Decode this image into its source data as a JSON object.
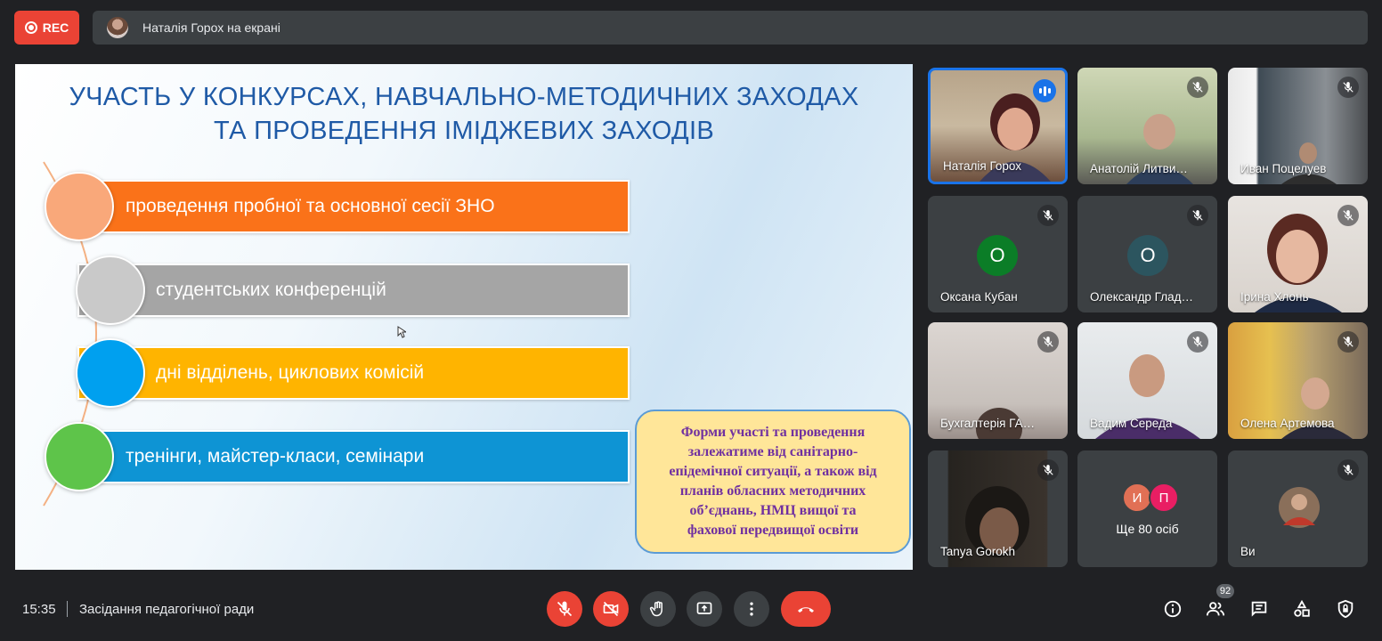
{
  "top_bar": {
    "rec_label": "REC",
    "presenter_text": "Наталія Горох на екрані"
  },
  "slide": {
    "title_line1": "УЧАСТЬ У КОНКУРСАХ, НАВЧАЛЬНО-МЕТОДИЧНИХ ЗАХОДАХ",
    "title_line2": "ТА ПРОВЕДЕННЯ ІМІДЖЕВИХ ЗАХОДІВ",
    "items": [
      {
        "label": "проведення пробної та основної сесії ЗНО",
        "bar_color": "#fa7219",
        "circle_color": "#f9a87a"
      },
      {
        "label": "студентських конференцій",
        "bar_color": "#a5a5a5",
        "circle_color": "#c9c9c9"
      },
      {
        "label": "дні відділень, циклових комісій",
        "bar_color": "#ffb400",
        "circle_color": "#00a0ef"
      },
      {
        "label": "тренінги, майстер-класи, семінари",
        "bar_color": "#0e94d4",
        "circle_color": "#5ec44a"
      }
    ],
    "note_lines": [
      "Форми  участі та проведення",
      "залежатиме від санітарно-",
      "епідемічної ситуації, а також від",
      "планів обласних методичних",
      "об’єднань,  НМЦ вищої та",
      "фахової передвищої освіти"
    ]
  },
  "participants": [
    {
      "name": "Наталія Горох",
      "state": "speaking"
    },
    {
      "name": "Анатолій Литви…",
      "state": "muted"
    },
    {
      "name": "Иван Поцелуев",
      "state": "muted"
    },
    {
      "name": "Оксана Кубан",
      "state": "muted",
      "initial": "О",
      "avatar_color": "#0b7d27"
    },
    {
      "name": "Олександр Глад…",
      "state": "muted",
      "initial": "О",
      "avatar_color": "#2c555f"
    },
    {
      "name": "Ірина Хлонь",
      "state": "muted"
    },
    {
      "name": "Бухгалтерія ГА…",
      "state": "muted"
    },
    {
      "name": "Вадим Середа",
      "state": "muted"
    },
    {
      "name": "Олена Артемова",
      "state": "muted"
    },
    {
      "name": "Tanya Gorokh",
      "state": "muted"
    },
    {
      "name": "Ще 80 осіб",
      "initials": [
        "И",
        "П"
      ],
      "avatar_colors": [
        "#e17055",
        "#e91e63"
      ]
    },
    {
      "name": "Ви",
      "state": "muted"
    }
  ],
  "bottom_bar": {
    "time": "15:35",
    "meeting_title": "Засідання педагогічної ради",
    "people_count": "92"
  },
  "colors": {
    "danger": "#ea4335",
    "control_grey": "#3c4043",
    "background": "#202124",
    "speaking_accent": "#1a73e8"
  }
}
